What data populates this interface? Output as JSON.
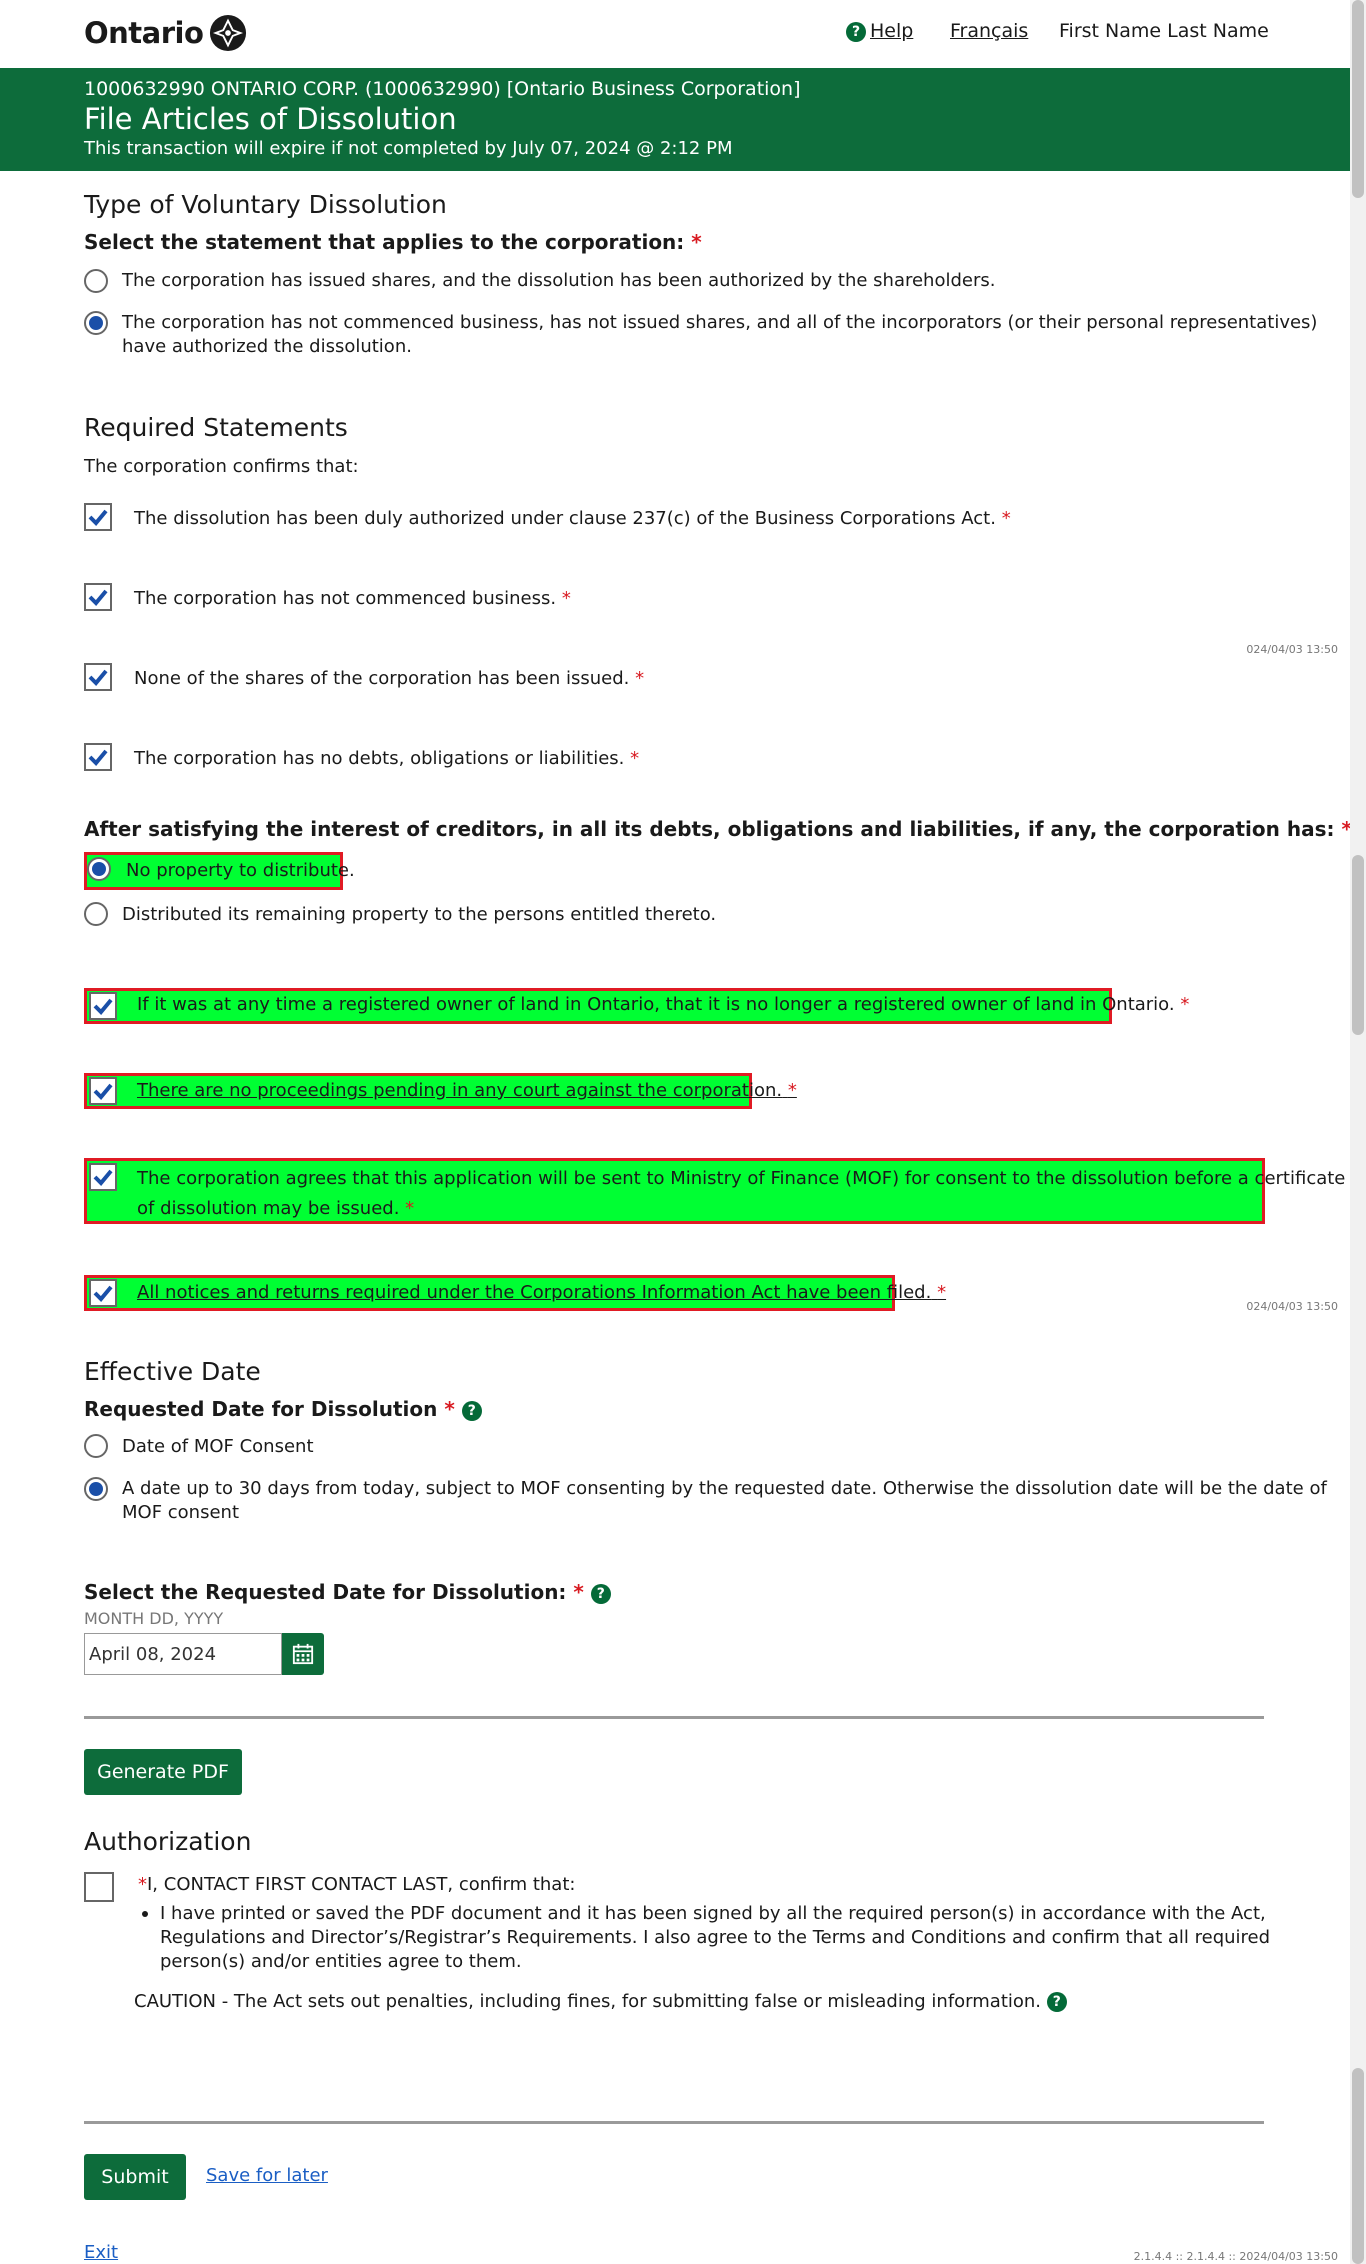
{
  "header": {
    "logo_text": "Ontario",
    "help_label": "Help",
    "lang_label": "Français",
    "user_name": "First Name Last Name"
  },
  "banner": {
    "company": "1000632990 ONTARIO CORP. (1000632990) [Ontario Business Corporation]",
    "title": "File Articles of Dissolution",
    "expiry": "This transaction will expire if not completed by July 07, 2024 @ 2:12 PM"
  },
  "dissolution_type": {
    "heading": "Type of Voluntary Dissolution",
    "question": "Select the statement that applies to the corporation:",
    "required_mark": "*",
    "option1": "The corporation has issued shares, and the dissolution has been authorized by the shareholders.",
    "option2_line1": "The corporation has not commenced business, has not issued shares, and all of the incorporators (or their personal representatives)",
    "option2_line2": "have authorized the dissolution.",
    "selected": 2
  },
  "required_statements": {
    "heading": "Required Statements",
    "intro": "The corporation confirms that:",
    "items": [
      "The dissolution has been duly authorized under clause 237(c) of the Business Corporations Act.",
      "The corporation has not commenced business.",
      "None of the shares of the corporation has been issued.",
      "The corporation has no debts, obligations or liabilities."
    ],
    "side_note": "024/04/03 13:50"
  },
  "property": {
    "question": "After satisfying the interest of creditors, in all its debts, obligations and liabilities, if any, the corporation has:",
    "option1": "No property to distribute.",
    "option2": "Distributed its remaining property to the persons entitled thereto.",
    "selected": 1
  },
  "highlighted_statements": {
    "items": [
      "If it was at any time a registered owner of land in Ontario, that it is no longer a registered owner of land in Ontario.",
      "There are no proceedings pending in any court against the corporation.",
      "The corporation agrees that this application will be sent to Ministry of Finance (MOF) for consent to the dissolution before a certificate",
      "of dissolution may be issued.",
      "All notices and returns required under the Corporations Information Act have been filed."
    ],
    "side_note": "024/04/03 13:50"
  },
  "effective_date": {
    "heading": "Effective Date",
    "question": "Requested Date for Dissolution",
    "option1": "Date of MOF Consent",
    "option2_line1": "A date up to 30 days from today, subject to MOF consenting by the requested date. Otherwise the dissolution date will be the date of",
    "option2_line2": "MOF consent",
    "selected": 2,
    "date_question": "Select the Requested Date for Dissolution:",
    "date_format": "MONTH DD, YYYY",
    "date_value": "April 08, 2024"
  },
  "actions": {
    "generate_pdf": "Generate PDF",
    "submit": "Submit",
    "save_for_later": "Save for later",
    "exit": "Exit"
  },
  "authorization": {
    "heading": "Authorization",
    "confirm": "I, CONTACT FIRST CONTACT LAST, confirm that:",
    "bullet_line1": "I have printed or saved the PDF document and it has been signed by all the required person(s) in accordance with the Act,",
    "bullet_line2": "Regulations and Director’s/Registrar’s Requirements. I also agree to the Terms and Conditions and confirm that all required",
    "bullet_line3": "person(s) and/or entities agree to them.",
    "caution": "CAUTION - The Act sets out penalties, including fines, for submitting false or misleading information."
  },
  "footer": {
    "version": "2.1.4.4 :: 2.1.4.4 :: 2024/04/03 13:50"
  },
  "colors": {
    "brand_green": "#0d6c3b",
    "highlight_green": "#00ff33",
    "highlight_border": "#e01b24",
    "required_red": "#d81a21",
    "radio_blue": "#1a4fa8"
  },
  "icons": [
    "ontario-trillium-icon",
    "help-icon",
    "checkmark-icon",
    "calendar-icon"
  ]
}
